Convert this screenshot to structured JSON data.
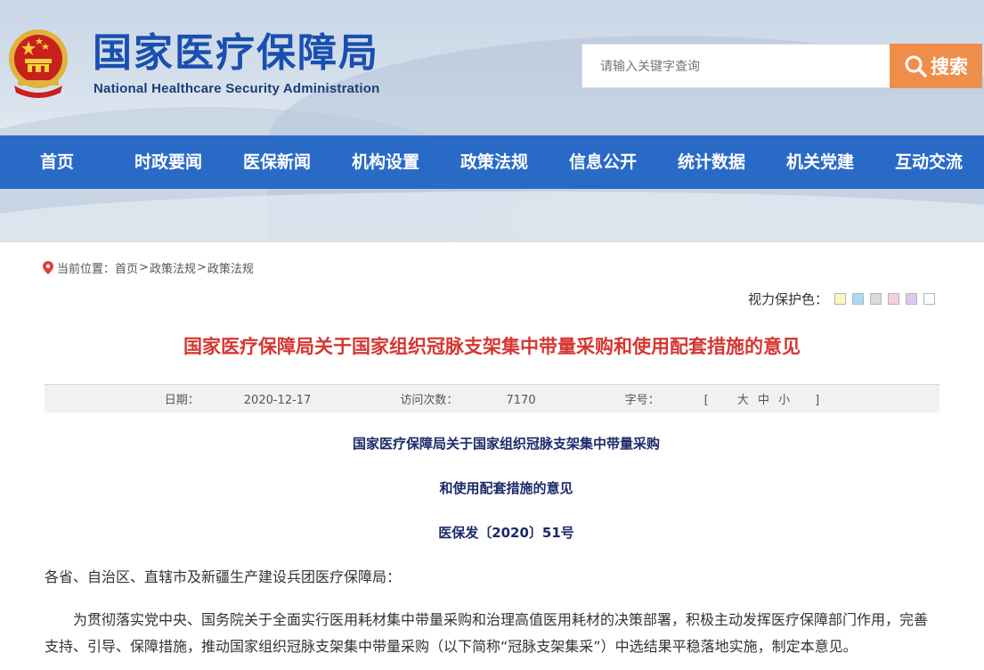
{
  "header": {
    "title": "国家医疗保障局",
    "subtitle": "National Healthcare Security Administration",
    "search": {
      "placeholder": "请输入关键字查询",
      "button_label": "搜索"
    }
  },
  "nav": {
    "items": [
      "首页",
      "时政要闻",
      "医保新闻",
      "机构设置",
      "政策法规",
      "信息公开",
      "统计数据",
      "机关党建",
      "互动交流"
    ]
  },
  "breadcrumb": {
    "prefix": "当前位置：",
    "items": [
      "首页",
      "政策法规",
      "政策法规"
    ],
    "separator": ">"
  },
  "vision": {
    "label": "视力保护色：",
    "swatches": [
      "#fbf7c0",
      "#a9dcf0",
      "#dcdcdc",
      "#f6cfe2",
      "#dcc7f0",
      "#ffffff"
    ]
  },
  "article": {
    "title": "国家医疗保障局关于国家组织冠脉支架集中带量采购和使用配套措施的意见",
    "meta": {
      "date_label": "日期：",
      "date": "2020-12-17",
      "visits_label": "访问次数：",
      "visits": "7170",
      "font_label": "字号：",
      "font_open": "[",
      "font_large": "大",
      "font_medium": "中",
      "font_small": "小",
      "font_close": "]"
    },
    "doc_title_line1": "国家医疗保障局关于国家组织冠脉支架集中带量采购",
    "doc_title_line2": "和使用配套措施的意见",
    "doc_number": "医保发〔2020〕51号",
    "salutation": "各省、自治区、直辖市及新疆生产建设兵团医疗保障局：",
    "body_line1": "为贯彻落实党中央、国务院关于全面实行医用耗材集中带量采购和治理高值医用耗材的决策部署，积极主动发挥医疗保障部门作用，完善",
    "body_line2": "支持、引导、保障措施，推动国家组织冠脉支架集中带量采购（以下简称“冠脉支架集采”）中选结果平稳落地实施，制定本意见。"
  },
  "colors": {
    "nav_bg": "#2a6ac7",
    "title_blue": "#1a4fb0",
    "search_button": "#ef8d4a",
    "article_title": "#d63631",
    "doc_heading": "#1b2a6b"
  }
}
